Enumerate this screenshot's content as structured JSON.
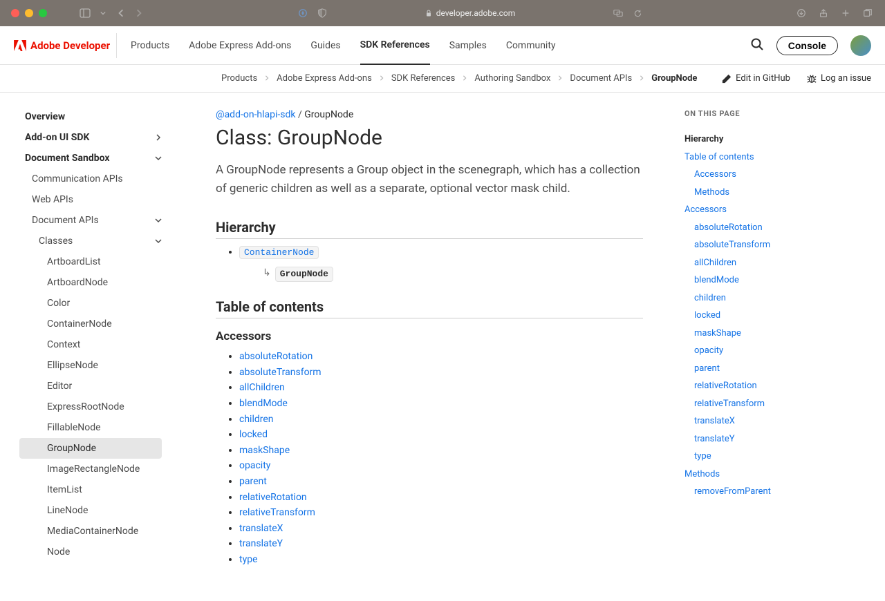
{
  "browser": {
    "url": "developer.adobe.com"
  },
  "topnav": {
    "brand": "Adobe Developer",
    "items": [
      "Products",
      "Adobe Express Add-ons",
      "Guides",
      "SDK References",
      "Samples",
      "Community"
    ],
    "active_index": 3,
    "console_label": "Console"
  },
  "secondary": {
    "breadcrumbs": [
      "Products",
      "Adobe Express Add-ons",
      "SDK References",
      "Authoring Sandbox",
      "Document APIs",
      "GroupNode"
    ],
    "edit_label": "Edit in GitHub",
    "log_label": "Log an issue"
  },
  "sidebar": {
    "overview": "Overview",
    "addon_sdk": "Add-on UI SDK",
    "doc_sandbox": "Document Sandbox",
    "comm_apis": "Communication APIs",
    "web_apis": "Web APIs",
    "doc_apis": "Document APIs",
    "classes": "Classes",
    "class_items": [
      "ArtboardList",
      "ArtboardNode",
      "Color",
      "ContainerNode",
      "Context",
      "EllipseNode",
      "Editor",
      "ExpressRootNode",
      "FillableNode",
      "GroupNode",
      "ImageRectangleNode",
      "ItemList",
      "LineNode",
      "MediaContainerNode",
      "Node"
    ],
    "selected_class": "GroupNode"
  },
  "page": {
    "crumb_pkg": "@add-on-hlapi-sdk",
    "crumb_current": "GroupNode",
    "title": "Class: GroupNode",
    "lead": "A GroupNode represents a Group object in the scenegraph, which has a collection of generic children as well as a separate, optional vector mask child.",
    "hierarchy_heading": "Hierarchy",
    "hierarchy_parent": "ContainerNode",
    "hierarchy_current": "GroupNode",
    "toc_heading": "Table of contents",
    "accessors_heading": "Accessors",
    "accessors": [
      "absoluteRotation",
      "absoluteTransform",
      "allChildren",
      "blendMode",
      "children",
      "locked",
      "maskShape",
      "opacity",
      "parent",
      "relativeRotation",
      "relativeTransform",
      "translateX",
      "translateY",
      "type"
    ]
  },
  "toc": {
    "title": "ON THIS PAGE",
    "items": [
      {
        "label": "Hierarchy",
        "bold": true,
        "indent": 0
      },
      {
        "label": "Table of contents",
        "bold": false,
        "indent": 0
      },
      {
        "label": "Accessors",
        "bold": false,
        "indent": 1
      },
      {
        "label": "Methods",
        "bold": false,
        "indent": 1
      },
      {
        "label": "Accessors",
        "bold": false,
        "indent": 0
      },
      {
        "label": "absoluteRotation",
        "bold": false,
        "indent": 1
      },
      {
        "label": "absoluteTransform",
        "bold": false,
        "indent": 1
      },
      {
        "label": "allChildren",
        "bold": false,
        "indent": 1
      },
      {
        "label": "blendMode",
        "bold": false,
        "indent": 1
      },
      {
        "label": "children",
        "bold": false,
        "indent": 1
      },
      {
        "label": "locked",
        "bold": false,
        "indent": 1
      },
      {
        "label": "maskShape",
        "bold": false,
        "indent": 1
      },
      {
        "label": "opacity",
        "bold": false,
        "indent": 1
      },
      {
        "label": "parent",
        "bold": false,
        "indent": 1
      },
      {
        "label": "relativeRotation",
        "bold": false,
        "indent": 1
      },
      {
        "label": "relativeTransform",
        "bold": false,
        "indent": 1
      },
      {
        "label": "translateX",
        "bold": false,
        "indent": 1
      },
      {
        "label": "translateY",
        "bold": false,
        "indent": 1
      },
      {
        "label": "type",
        "bold": false,
        "indent": 1
      },
      {
        "label": "Methods",
        "bold": false,
        "indent": 0
      },
      {
        "label": "removeFromParent",
        "bold": false,
        "indent": 1
      }
    ]
  }
}
